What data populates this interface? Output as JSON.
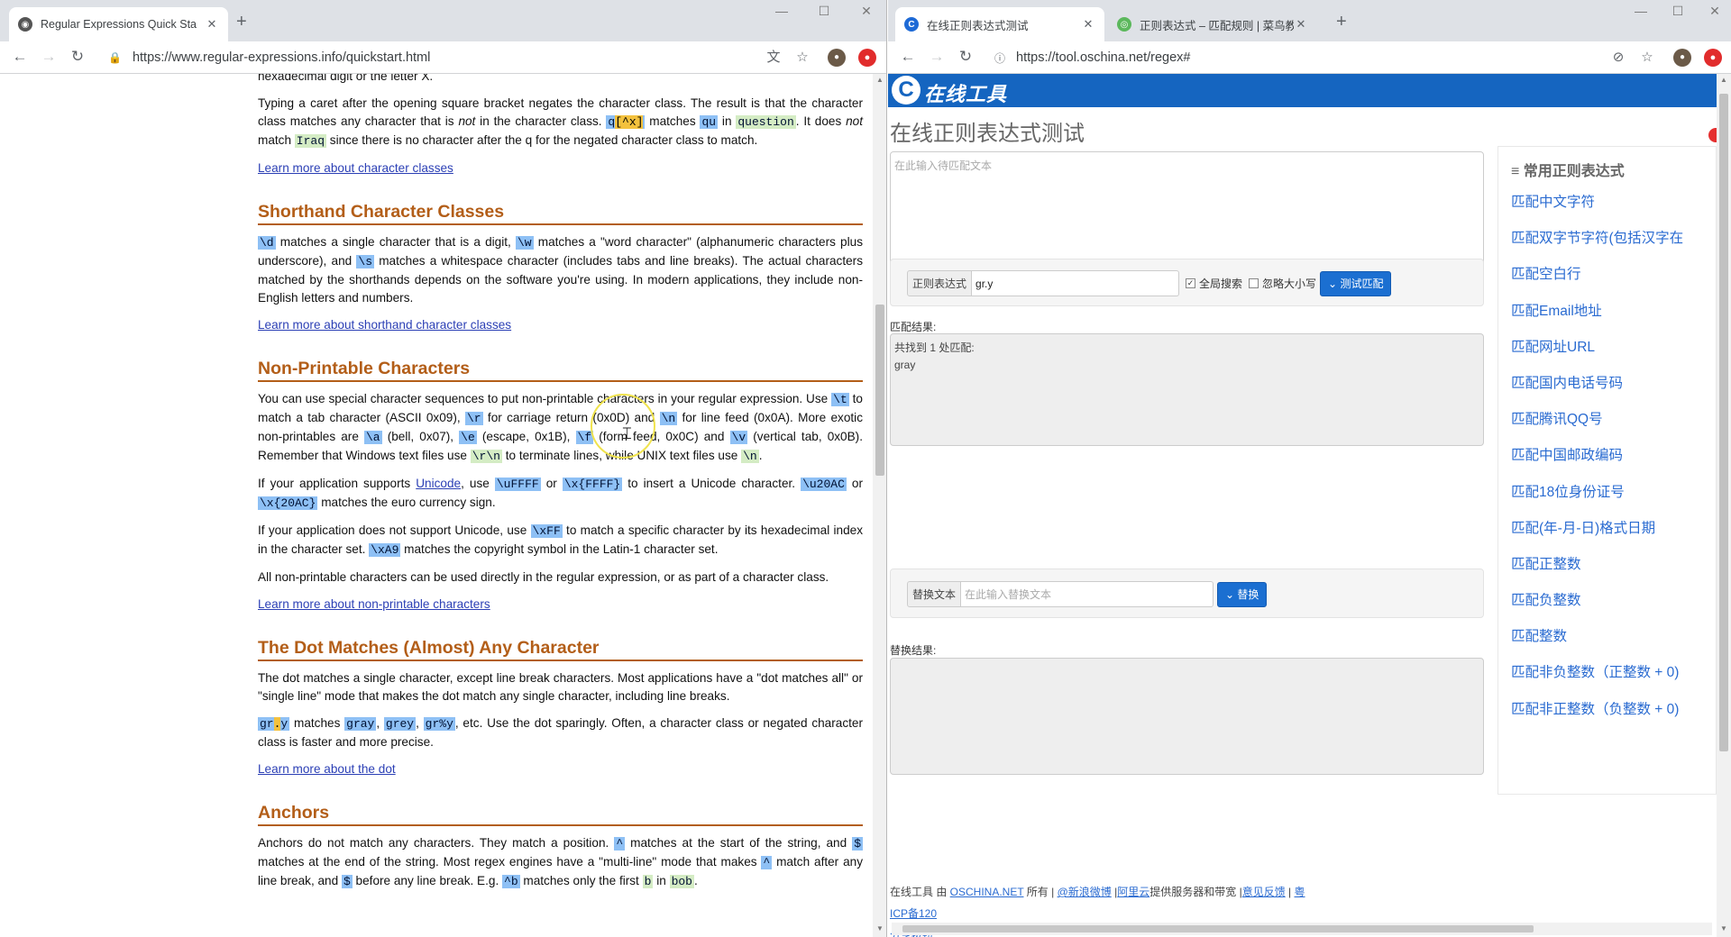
{
  "left": {
    "tab": {
      "title": "Regular Expressions Quick Sta"
    },
    "url": "https://www.regular-expressions.info/quickstart.html",
    "article": {
      "intro_tail": "hexadecimal digit or the letter X.",
      "caret": {
        "t1": "Typing a caret after the opening square bracket negates the character class. The result is that the character class matches any character that is ",
        "em1": "not",
        "t2": " in the character class. ",
        "c1a": "q",
        "c1b": "[^x]",
        "t3": " matches ",
        "c2": "qu",
        "t4": " in ",
        "c3": "question",
        "t5": ". It does ",
        "em2": "not",
        "t6": " match ",
        "c4": "Iraq",
        "t7": " since there is no character after the q for the negated character class to match."
      },
      "link_classes": "Learn more about character classes",
      "h_shorthand": "Shorthand Character Classes",
      "shorthand": {
        "c1": "\\d",
        "t1": " matches a single character that is a digit, ",
        "c2": "\\w",
        "t2": " matches a \"word character\" (alphanumeric characters plus underscore), and ",
        "c3": "\\s",
        "t3": " matches a whitespace character (includes tabs and line breaks). The actual characters matched by the shorthands depends on the software you're using. In modern applications, they include non-English letters and numbers."
      },
      "link_shorthand": "Learn more about shorthand character classes",
      "h_nonprint": "Non-Printable Characters",
      "np1": {
        "t1": "You can use special character sequences to put non-printable characters in your regular expression. Use ",
        "c1": "\\t",
        "t2": " to match a tab character (ASCII 0x09), ",
        "c2": "\\r",
        "t3": " for carriage return (0x0D) and ",
        "c3": "\\n",
        "t4": " for line feed (0x0A). More exotic non-printables are ",
        "c4": "\\a",
        "t5": " (bell, 0x07), ",
        "c5": "\\e",
        "t6": " (escape, 0x1B), ",
        "c6": "\\f",
        "t7": " (form feed, 0x0C) and ",
        "c7": "\\v",
        "t8": " (vertical tab, 0x0B). Remember that Windows text files use ",
        "c8": "\\r\\n",
        "t9": " to terminate lines, while UNIX text files use ",
        "c9": "\\n",
        "t10": "."
      },
      "np2": {
        "t1": "If your application supports ",
        "link": "Unicode",
        "t2": ", use ",
        "c1": "\\uFFFF",
        "t3": " or ",
        "c2": "\\x{FFFF}",
        "t4": " to insert a Unicode character. ",
        "c3": "\\u20AC",
        "t5": " or ",
        "c4": "\\x{20AC}",
        "t6": " matches the euro currency sign."
      },
      "np3": {
        "t1": "If your application does not support Unicode, use ",
        "c1": "\\xFF",
        "t2": " to match a specific character by its hexadecimal index in the character set. ",
        "c2": "\\xA9",
        "t3": " matches the copyright symbol in the Latin-1 character set."
      },
      "np4": "All non-printable characters can be used directly in the regular expression, or as part of a character class.",
      "link_nonprint": "Learn more about non-printable characters",
      "h_dot": "The Dot Matches (Almost) Any Character",
      "dot1": "The dot matches a single character, except line break characters. Most applications have a \"dot matches all\" or \"single line\" mode that makes the dot match any single character, including line breaks.",
      "dot2": {
        "c1a": "gr",
        "c1b": ".",
        "c1c": "y",
        "t1": " matches ",
        "c2": "gray",
        "t2": ", ",
        "c3": "grey",
        "t3": ", ",
        "c4": "gr%y",
        "t4": ", etc. Use the dot sparingly. Often, a character class or negated character class is faster and more precise."
      },
      "link_dot": "Learn more about the dot",
      "h_anchors": "Anchors",
      "anc": {
        "t1": "Anchors do not match any characters. They match a position. ",
        "c1": "^",
        "t2": " matches at the start of the string, and ",
        "c2": "$",
        "t3": " matches at the end of the string. Most regex engines have a \"multi-line\" mode that makes ",
        "c3": "^",
        "t4": " match after any line break, and ",
        "c4": "$",
        "t5": " before any line break. E.g. ",
        "c5": "^b",
        "t6": " matches only the first ",
        "c6": "b",
        "t7": " in ",
        "c7": "bob",
        "t8": "."
      }
    }
  },
  "right": {
    "tab1": {
      "title": "在线正则表达式测试"
    },
    "tab2": {
      "title": "正则表达式 – 匹配规则 | 菜鸟教"
    },
    "url": "https://tool.oschina.net/regex#",
    "logo_text": "在线工具",
    "page_title": "在线正则表达式测试",
    "input_placeholder": "在此输入待匹配文本",
    "regex_label": "正则表达式",
    "regex_value": "gr.y",
    "global_label": "全局搜索",
    "ignorecase_label": "忽略大小写",
    "test_button": "测试匹配",
    "result_label": "匹配结果:",
    "result_line1": "共找到 1 处匹配:",
    "result_line2": "gray",
    "replace_label": "替换文本",
    "replace_placeholder": "在此输入替换文本",
    "replace_button": "替换",
    "replace_result_label": "替换结果:",
    "sidebar_title": "常用正则表达式",
    "sidebar_items": [
      "匹配中文字符",
      "匹配双字节字符(包括汉字在",
      "匹配空白行",
      "匹配Email地址",
      "匹配网址URL",
      "匹配国内电话号码",
      "匹配腾讯QQ号",
      "匹配中国邮政编码",
      "匹配18位身份证号",
      "匹配(年-月-日)格式日期",
      "匹配正整数",
      "匹配负整数",
      "匹配整数",
      "匹配非负整数（正整数 + 0)",
      "匹配非正整数（负整数 + 0)"
    ],
    "footer": {
      "t1": "在线工具 由 ",
      "oschina": "OSCHINA.NET",
      "t2": " 所有 | ",
      "weibo": "@新浪微博",
      "t3": " |",
      "aliyun": "阿里云",
      "t4": "提供服务器和带宽 |",
      "feedback": "意见反馈",
      "t5": " | ",
      "icp": "粤ICP备120",
      "share": "分享按钮"
    }
  },
  "colors": {
    "heading": "#b35e18",
    "link": "#2b3fb5",
    "banner": "#1565c0",
    "button": "#1b6fd1"
  }
}
